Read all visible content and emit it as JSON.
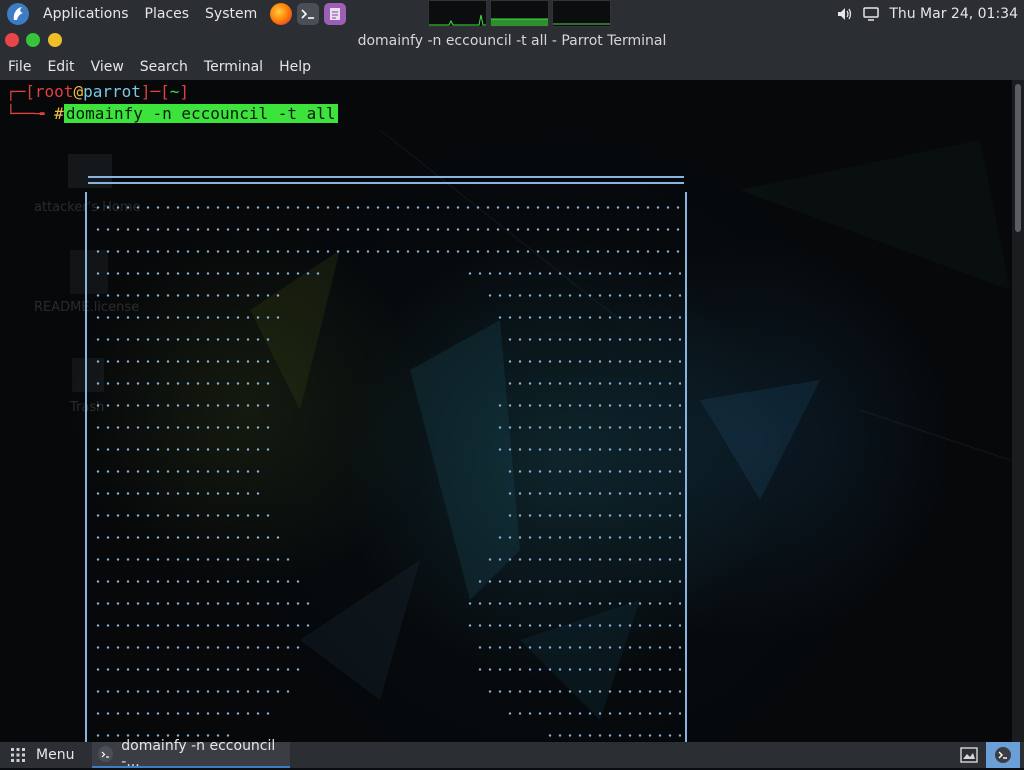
{
  "top_panel": {
    "menus": [
      "Applications",
      "Places",
      "System"
    ],
    "launchers": [
      "firefox-icon",
      "terminal-icon",
      "text-editor-icon"
    ],
    "clock": "Thu Mar 24, 01:34",
    "tray_icons": [
      "volume-icon",
      "display-icon"
    ]
  },
  "window": {
    "title": "domainfy -n eccouncil -t all - Parrot Terminal",
    "menubar": [
      "File",
      "Edit",
      "View",
      "Search",
      "Terminal",
      "Help"
    ]
  },
  "terminal": {
    "prompt_line1_open": "┌─[",
    "prompt_user": "root",
    "prompt_at": "@",
    "prompt_host": "parrot",
    "prompt_mid": "]─[",
    "prompt_dir": "~",
    "prompt_close": "]",
    "prompt_line2": "└──╼ ",
    "prompt_symbol": "#",
    "command": "domainfy -n eccouncil -t all"
  },
  "desktop_ghost": {
    "items": [
      "attacker's Home",
      "README.license",
      "Trash"
    ]
  },
  "taskbar": {
    "menu_label": "Menu",
    "task_label": "domainfy -n eccouncil -...",
    "tray_icons": [
      "screenshot-tool-icon",
      "terminal-icon"
    ]
  },
  "colors": {
    "panel_bg": "#2b2e33",
    "prompt_red": "#e04040",
    "prompt_host": "#7ec8e3",
    "command_highlight": "#3de33d",
    "banner_blue": "#8ab4e0",
    "accent": "#3e7cc4"
  }
}
